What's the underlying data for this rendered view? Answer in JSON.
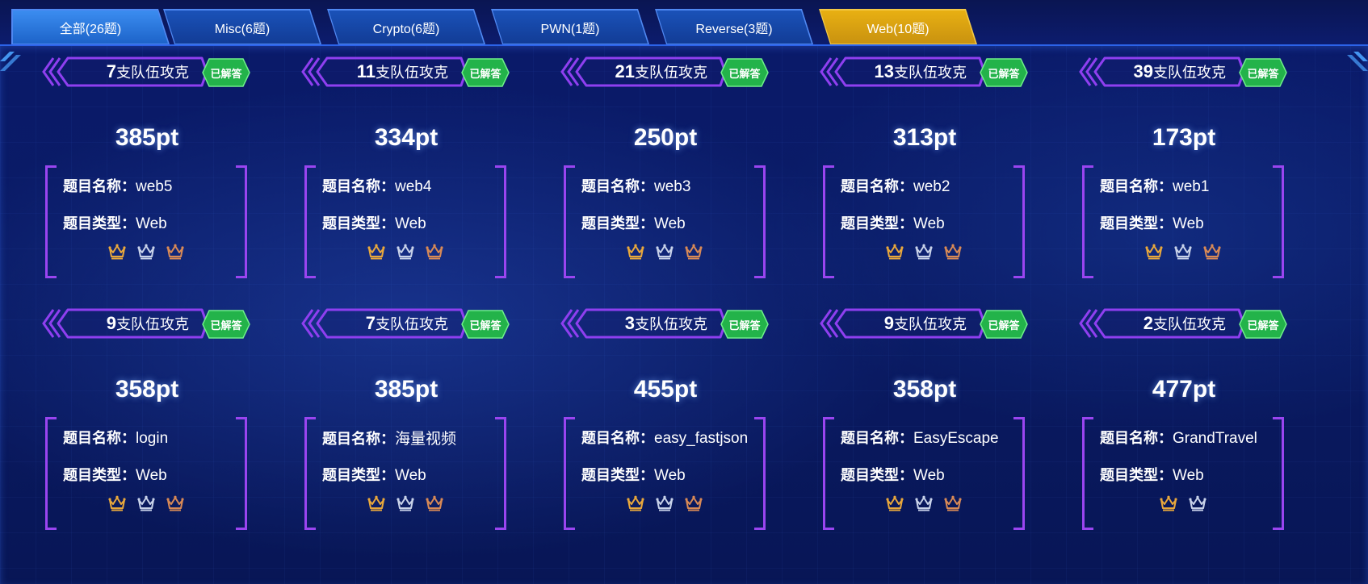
{
  "tabs": [
    {
      "label": "全部(26题)",
      "state": "first"
    },
    {
      "label": "Misc(6题)",
      "state": ""
    },
    {
      "label": "Crypto(6题)",
      "state": ""
    },
    {
      "label": "PWN(1题)",
      "state": ""
    },
    {
      "label": "Reverse(3题)",
      "state": ""
    },
    {
      "label": "Web(10题)",
      "state": "active"
    }
  ],
  "labels": {
    "team_suffix": "支队伍攻克",
    "solved": "已解答",
    "name_label": "题目名称：",
    "type_label": "题目类型：",
    "score_unit": "pt"
  },
  "colors": {
    "gold": "#e9a83c",
    "silver": "#c9d3ea",
    "bronze": "#d98a56",
    "solved_badge": "#23b34a",
    "ribbon": "#8f3ff0"
  },
  "cards": [
    {
      "teams": "7",
      "score": "385pt",
      "name": "web5",
      "type": "Web",
      "crowns": [
        "gold",
        "silver",
        "bronze"
      ]
    },
    {
      "teams": "11",
      "score": "334pt",
      "name": "web4",
      "type": "Web",
      "crowns": [
        "gold",
        "silver",
        "bronze"
      ]
    },
    {
      "teams": "21",
      "score": "250pt",
      "name": "web3",
      "type": "Web",
      "crowns": [
        "gold",
        "silver",
        "bronze"
      ]
    },
    {
      "teams": "13",
      "score": "313pt",
      "name": "web2",
      "type": "Web",
      "crowns": [
        "gold",
        "silver",
        "bronze"
      ]
    },
    {
      "teams": "39",
      "score": "173pt",
      "name": "web1",
      "type": "Web",
      "crowns": [
        "gold",
        "silver",
        "bronze"
      ]
    },
    {
      "teams": "9",
      "score": "358pt",
      "name": "login",
      "type": "Web",
      "crowns": [
        "gold",
        "silver",
        "bronze"
      ]
    },
    {
      "teams": "7",
      "score": "385pt",
      "name": "海量视频",
      "type": "Web",
      "crowns": [
        "gold",
        "silver",
        "bronze"
      ]
    },
    {
      "teams": "3",
      "score": "455pt",
      "name": "easy_fastjson",
      "type": "Web",
      "crowns": [
        "gold",
        "silver",
        "bronze"
      ]
    },
    {
      "teams": "9",
      "score": "358pt",
      "name": "EasyEscape",
      "type": "Web",
      "crowns": [
        "gold",
        "silver",
        "bronze"
      ]
    },
    {
      "teams": "2",
      "score": "477pt",
      "name": "GrandTravel",
      "type": "Web",
      "crowns": [
        "gold",
        "silver"
      ]
    }
  ]
}
